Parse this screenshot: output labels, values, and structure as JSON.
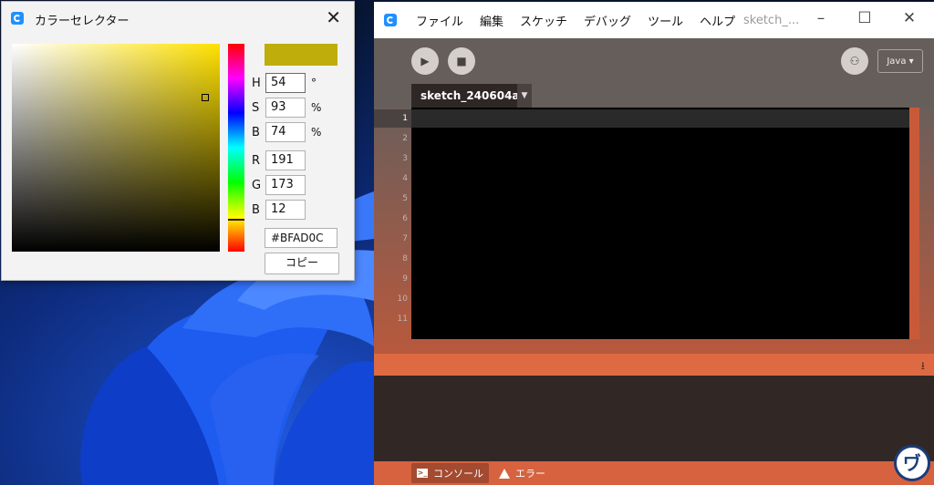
{
  "color_selector": {
    "title": "カラーセレクター",
    "close_symbol": "✕",
    "preview_color": "#bfad0c",
    "fields": {
      "h": {
        "label": "H",
        "value": "54",
        "unit": "°"
      },
      "s": {
        "label": "S",
        "value": "93",
        "unit": "%"
      },
      "b1": {
        "label": "B",
        "value": "74",
        "unit": "%"
      },
      "r": {
        "label": "R",
        "value": "191"
      },
      "g": {
        "label": "G",
        "value": "173"
      },
      "b2": {
        "label": "B",
        "value": "12"
      }
    },
    "hex": "#BFAD0C",
    "copy_label": "コピー"
  },
  "ide": {
    "menu": [
      "ファイル",
      "編集",
      "スケッチ",
      "デバッグ",
      "ツール",
      "ヘルプ"
    ],
    "window_title": "sketch_...",
    "run_symbol": "▶",
    "stop_symbol": "■",
    "debug_symbol": "⚇",
    "mode_label": "Java",
    "mode_arrow": "▾",
    "tab_label": "sketch_240604a",
    "tab_dropdown": "▼",
    "line_numbers": [
      "1",
      "2",
      "3",
      "4",
      "5",
      "6",
      "7",
      "8",
      "9",
      "10",
      "11"
    ],
    "collapse_symbol": "⭳",
    "console_label": "コンソール",
    "error_label": "エラー",
    "console_icon_text": ">_"
  },
  "watermark_text": "ヷ"
}
